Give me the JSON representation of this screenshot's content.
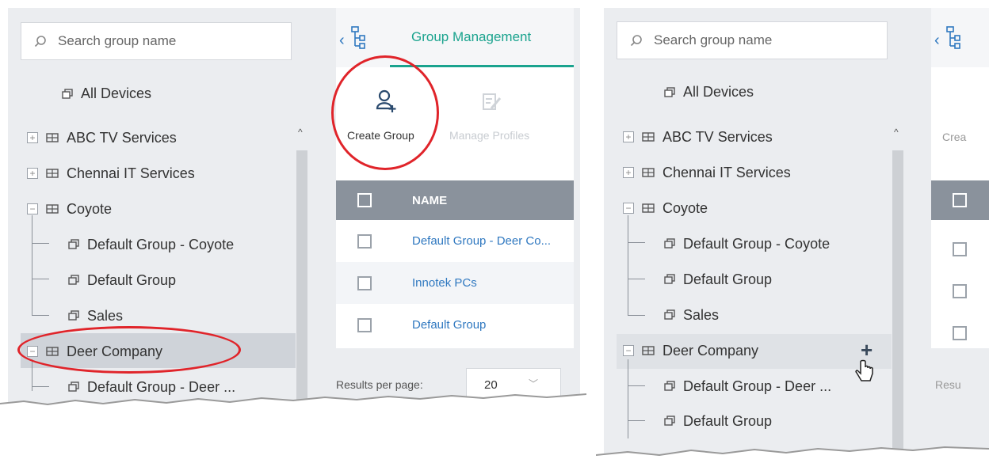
{
  "left_tree": {
    "search_placeholder": "Search group name",
    "all_devices": "All Devices",
    "items": [
      {
        "label": "ABC TV Services"
      },
      {
        "label": "Chennai IT Services"
      },
      {
        "label": "Coyote"
      },
      {
        "label": "Default Group - Coyote"
      },
      {
        "label": "Default Group"
      },
      {
        "label": "Sales"
      },
      {
        "label": "Deer Company"
      },
      {
        "label": "Default Group - Deer ..."
      }
    ]
  },
  "group_management": {
    "tab_label": "Group Management",
    "create_group_label": "Create Group",
    "manage_profiles_label": "Manage Profiles",
    "column_name": "NAME",
    "rows": [
      {
        "name": "Default Group - Deer Co..."
      },
      {
        "name": "Innotek PCs"
      },
      {
        "name": "Default Group"
      }
    ],
    "results_per_page_label": "Results per page:",
    "results_per_page_value": "20"
  },
  "right_tree": {
    "search_placeholder": "Search group name",
    "all_devices": "All Devices",
    "items": [
      {
        "label": "ABC TV Services"
      },
      {
        "label": "Chennai IT Services"
      },
      {
        "label": "Coyote"
      },
      {
        "label": "Default Group - Coyote"
      },
      {
        "label": "Default Group"
      },
      {
        "label": "Sales"
      },
      {
        "label": "Deer Company"
      },
      {
        "label": "Default Group - Deer ..."
      },
      {
        "label": "Default Group"
      }
    ],
    "add_symbol": "+",
    "partial_labels": {
      "create": "Crea",
      "results": "Resu"
    }
  },
  "colors": {
    "accent": "#1aa38e",
    "highlight_ring": "#e0242a",
    "link": "#2f78c0",
    "panel_bg": "#ebedf0",
    "grid_header": "#8a929c"
  }
}
